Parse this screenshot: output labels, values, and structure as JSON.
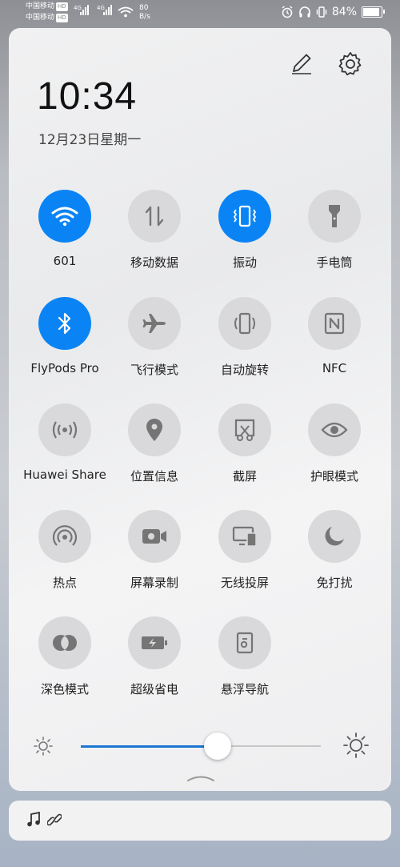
{
  "status_bar": {
    "carrier1": "中国移动",
    "carrier2": "中国移动",
    "hd": "HD",
    "net1": "4G",
    "net2": "4G",
    "speed_value": "80",
    "speed_unit": "B/s",
    "battery": "84%",
    "battery_level": 0.84
  },
  "header": {
    "time": "10:34",
    "date": "12月23日星期一",
    "edit_icon": "pencil-icon",
    "settings_icon": "gear-icon"
  },
  "tiles": [
    {
      "label": "601",
      "icon": "wifi-icon",
      "on": true
    },
    {
      "label": "移动数据",
      "icon": "mobile-data-icon",
      "on": false
    },
    {
      "label": "振动",
      "icon": "vibrate-icon",
      "on": true
    },
    {
      "label": "手电筒",
      "icon": "flashlight-icon",
      "on": false
    },
    {
      "label": "FlyPods Pro",
      "icon": "bluetooth-icon",
      "on": true
    },
    {
      "label": "飞行模式",
      "icon": "airplane-icon",
      "on": false
    },
    {
      "label": "自动旋转",
      "icon": "auto-rotate-icon",
      "on": false
    },
    {
      "label": "NFC",
      "icon": "nfc-icon",
      "on": false
    },
    {
      "label": "Huawei Share",
      "icon": "huawei-share-icon",
      "on": false
    },
    {
      "label": "位置信息",
      "icon": "location-icon",
      "on": false
    },
    {
      "label": "截屏",
      "icon": "screenshot-icon",
      "on": false
    },
    {
      "label": "护眼模式",
      "icon": "eye-comfort-icon",
      "on": false
    },
    {
      "label": "热点",
      "icon": "hotspot-icon",
      "on": false
    },
    {
      "label": "屏幕录制",
      "icon": "screen-record-icon",
      "on": false
    },
    {
      "label": "无线投屏",
      "icon": "wireless-projection-icon",
      "on": false
    },
    {
      "label": "免打扰",
      "icon": "do-not-disturb-icon",
      "on": false
    },
    {
      "label": "深色模式",
      "icon": "dark-mode-icon",
      "on": false
    },
    {
      "label": "超级省电",
      "icon": "power-saving-icon",
      "on": false
    },
    {
      "label": "悬浮导航",
      "icon": "floating-nav-icon",
      "on": false
    }
  ],
  "brightness": {
    "level": 0.57,
    "accent": "#1a76d2"
  },
  "colors": {
    "active": "#0a84f5",
    "inactive": "#d9d9db"
  },
  "music": {
    "note_icon": "music-note-icon",
    "link_icon": "link-icon"
  }
}
